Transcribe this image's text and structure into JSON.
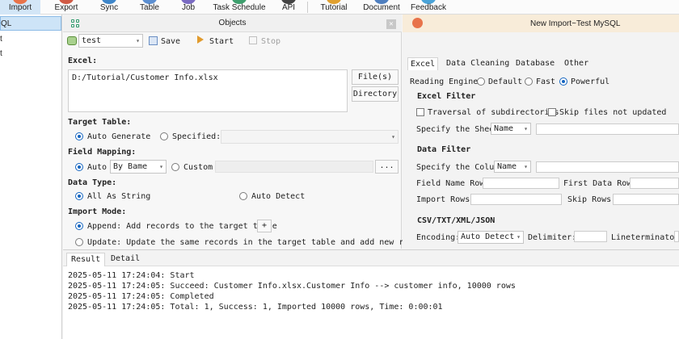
{
  "toolbar": {
    "items": [
      {
        "label": "Import",
        "icon": "import-icon",
        "color": "#e8734a"
      },
      {
        "label": "Export",
        "icon": "export-icon",
        "color": "#d05a45"
      },
      {
        "label": "Sync",
        "icon": "sync-icon",
        "color": "#3f86c9"
      },
      {
        "label": "Table",
        "icon": "table-icon",
        "color": "#5c8fd1"
      },
      {
        "label": "Job",
        "icon": "job-icon",
        "color": "#7a6bc2"
      },
      {
        "label": "Task Schedule",
        "icon": "task-schedule-icon",
        "color": "#3e9f6e"
      },
      {
        "label": "API",
        "icon": "api-icon",
        "color": "#444444"
      },
      {
        "label": "Tutorial",
        "icon": "tutorial-icon",
        "color": "#e0a030"
      },
      {
        "label": "Document",
        "icon": "document-icon",
        "color": "#4f7fbf"
      },
      {
        "label": "Feedback",
        "icon": "feedback-icon",
        "color": "#4aa3d8"
      }
    ]
  },
  "left_tree": {
    "items": [
      {
        "label": "QL",
        "selected": true
      },
      {
        "label": "t",
        "selected": false
      },
      {
        "label": "t",
        "selected": false
      }
    ]
  },
  "objects": {
    "title": "Objects",
    "close_glyph": "✕",
    "profile_value": "test",
    "save_label": "Save",
    "start_label": "Start",
    "stop_label": "Stop",
    "excel_label": "Excel:",
    "excel_path": "D:/Tutorial/Customer Info.xlsx",
    "files_button": "File(s)",
    "directory_button": "Directory",
    "target_table_label": "Target Table:",
    "auto_generate_label": "Auto Generate",
    "specified_label": "Specified:",
    "field_mapping_label": "Field Mapping:",
    "auto_label": "Auto",
    "by_name_value": "By Bame",
    "custom_label": "Custom",
    "ellipsis_button": "...",
    "data_type_label": "Data Type:",
    "all_as_string_label": "All As String",
    "auto_detect_label": "Auto Detect",
    "import_mode_label": "Import Mode:",
    "append_label": "Append: Add records to the target table",
    "plus_button": "+",
    "update_label": "Update: Update the same records in the target table and add new records"
  },
  "right": {
    "title": "New Import~Test MySQL",
    "tabs": [
      "Excel",
      "Data Cleaning",
      "Database",
      "Other"
    ],
    "reading_engine_label": "Reading Engine:",
    "engine_default": "Default",
    "engine_fast": "Fast",
    "engine_powerful": "Powerful",
    "excel_filter_label": "Excel Filter",
    "traversal_label": "Traversal of subdirectories",
    "skip_files_label": "Skip files not updated",
    "specify_sheet_label": "Specify the Sheet",
    "sheet_by_value": "Name",
    "data_filter_label": "Data Filter",
    "specify_column_label": "Specify the Column",
    "column_by_value": "Name",
    "field_name_row_label": "Field Name Row:",
    "first_data_row_label": "First Data Row:",
    "import_rows_label": "Import Rows:",
    "skip_rows_label": "Skip Rows:",
    "csv_label": "CSV/TXT/XML/JSON",
    "encoding_label": "Encoding:",
    "encoding_value": "Auto Detect",
    "delimiter_label": "Delimiter:",
    "lineterminator_label": "Lineterminator"
  },
  "bottom": {
    "tabs": [
      "Result",
      "Detail"
    ],
    "log": [
      "2025-05-11 17:24:04: Start",
      "2025-05-11 17:24:05: Succeed: Customer Info.xlsx.Customer Info --> customer info, 10000 rows",
      "2025-05-11 17:24:05: Completed",
      "2025-05-11 17:24:05: Total: 1, Success: 1, Imported 10000 rows, Time: 0:00:01"
    ]
  }
}
